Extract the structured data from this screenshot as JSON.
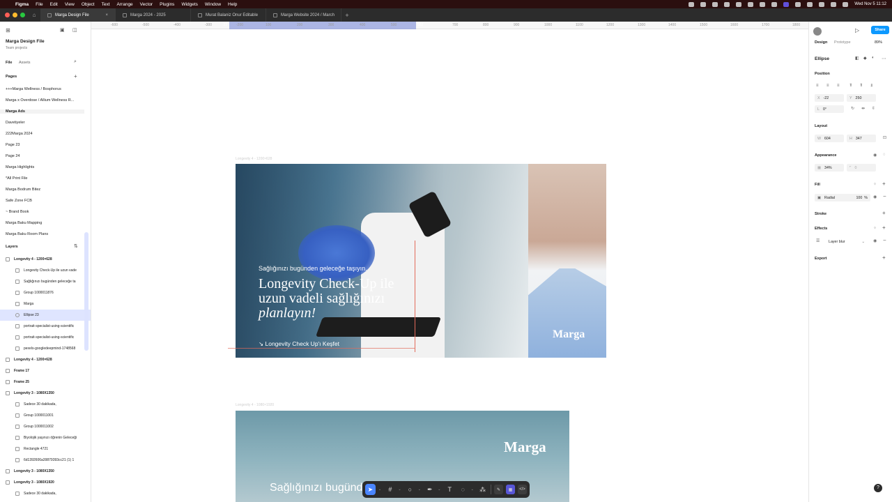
{
  "menubar": {
    "app": "Figma",
    "items": [
      "File",
      "Edit",
      "View",
      "Object",
      "Text",
      "Arrange",
      "Vector",
      "Plugins",
      "Widgets",
      "Window",
      "Help"
    ],
    "clock": "Wed Nov 5  11:12"
  },
  "tabs": [
    {
      "label": "Marga Design File",
      "active": true
    },
    {
      "label": "Marga 2024 - 2025",
      "active": false
    },
    {
      "label": "Murat Balaniz Onur Editable",
      "active": false
    },
    {
      "label": "Marga Website 2024 / March",
      "active": false
    }
  ],
  "file": {
    "name": "Marga Design File",
    "team": "Team projects"
  },
  "left_tabs": {
    "file": "File",
    "assets": "Assets"
  },
  "pages_title": "Pages",
  "pages": [
    "+++Marga Wellness / Bosphorus",
    "Marga x Overdose / Allium Wellness R...",
    "Marga Ads",
    "Davetiyeler",
    "222Marga 2024",
    "Page 23",
    "Page 24",
    "Marga Highlights",
    "*All Print File",
    "Marga Bodrum Bitez",
    "Safe Zone FCB",
    "~ Brand Book",
    "Marga Baku Mapping",
    "Marga Baku Room Plans"
  ],
  "layers_title": "Layers",
  "layers": [
    {
      "label": "Longevity 4 - 1200×628",
      "indent": 0,
      "bold": true
    },
    {
      "label": "Longevity Check-Up ile uzun vade",
      "indent": 2,
      "bold": false
    },
    {
      "label": "Sağlığınızı bugünden geleceğe ta",
      "indent": 2,
      "bold": false
    },
    {
      "label": "Group 1000011876",
      "indent": 2,
      "bold": false
    },
    {
      "label": "Marga",
      "indent": 2,
      "bold": false
    },
    {
      "label": "Ellipse 23",
      "indent": 2,
      "bold": false,
      "selected": true
    },
    {
      "label": "portrait-specialist-using-scientific",
      "indent": 2,
      "bold": false
    },
    {
      "label": "portrait-specialist-using-scientific",
      "indent": 2,
      "bold": false
    },
    {
      "label": "pexels-googledeepmind-1748568",
      "indent": 2,
      "bold": false
    },
    {
      "label": "Longevity 4 - 1200×628",
      "indent": 0,
      "bold": true
    },
    {
      "label": "Frame 17",
      "indent": 0,
      "bold": true
    },
    {
      "label": "Frame 25",
      "indent": 0,
      "bold": true
    },
    {
      "label": "Longevity 3 - 1080X1350",
      "indent": 0,
      "bold": true
    },
    {
      "label": "Sadece 30 dakikada,",
      "indent": 2,
      "bold": false
    },
    {
      "label": "Group 1000011001",
      "indent": 2,
      "bold": false
    },
    {
      "label": "Group 1000011002",
      "indent": 2,
      "bold": false
    },
    {
      "label": "Biyolojik yaşınızı öğrenin Geleceği",
      "indent": 2,
      "bold": false
    },
    {
      "label": "Rectangle 4721",
      "indent": 2,
      "bold": false
    },
    {
      "label": "6d1392606a39879393cc21 (1) 1",
      "indent": 2,
      "bold": false
    },
    {
      "label": "Longevity 3 - 1080X1350",
      "indent": 0,
      "bold": true
    },
    {
      "label": "Longevity 3 - 1080X1920",
      "indent": 0,
      "bold": true
    },
    {
      "label": "Sadece 30 dakikada,",
      "indent": 2,
      "bold": false
    }
  ],
  "ruler": {
    "ticks": [
      "-600",
      "-500",
      "-400",
      "-300",
      "-200",
      "-22",
      "100",
      "200",
      "300",
      "400",
      "500",
      "582",
      "700",
      "800",
      "900",
      "1000",
      "1100",
      "1200",
      "1300",
      "1400",
      "1500",
      "1600",
      "1700",
      "1800"
    ]
  },
  "canvas": {
    "frame1_label": "Longevity 4 - 1200×628",
    "frame1": {
      "subtitle": "Sağlığınızı bugünden geleceğe taşıyın.",
      "title_line1": "Longevity Check-Up ile",
      "title_line2": "uzun vadeli sağlığınızı",
      "title_line3": "planlayın!",
      "cta": "↘ Longevity Check Up'ı Keşfet",
      "logo": "Marga"
    },
    "frame2_label": "Longevity 4 - 1080×1920",
    "frame2": {
      "logo": "Marga",
      "text": "Sağlığınızı bugünde"
    }
  },
  "right": {
    "tab_design": "Design",
    "tab_prototype": "Prototype",
    "zoom": "89%",
    "share": "Share",
    "element": "Ellipse",
    "position_title": "Position",
    "x_label": "X",
    "x": "-22",
    "y_label": "Y",
    "y": "250",
    "rot_label": "L",
    "rotation": "0°",
    "layout_title": "Layout",
    "w_label": "W",
    "w": "604",
    "h_label": "H",
    "h": "347",
    "appearance_title": "Appearance",
    "opacity": "34%",
    "radius": "0",
    "fill_title": "Fill",
    "fill_type": "Radial",
    "fill_opacity": "100",
    "fill_pct": "%",
    "stroke_title": "Stroke",
    "effects_title": "Effects",
    "effect_name": "Layer blur",
    "export_title": "Export"
  },
  "help": "?"
}
